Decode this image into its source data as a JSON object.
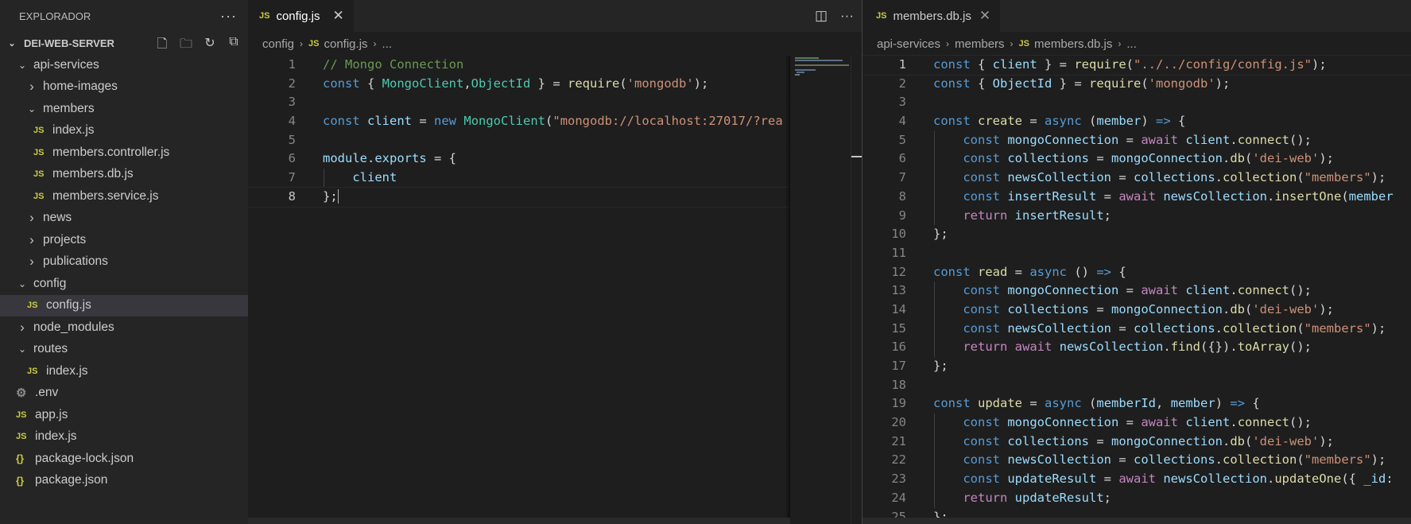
{
  "sidebar": {
    "title": "EXPLORADOR",
    "more_icon": "ellipsis-icon",
    "project": "DEI-WEB-SERVER",
    "tree": [
      {
        "label": "api-services",
        "kind": "folder-open",
        "depth": 1
      },
      {
        "label": "home-images",
        "kind": "folder-closed",
        "depth": 2
      },
      {
        "label": "members",
        "kind": "folder-open",
        "depth": 2
      },
      {
        "label": "index.js",
        "kind": "js",
        "depth": 3
      },
      {
        "label": "members.controller.js",
        "kind": "js",
        "depth": 3
      },
      {
        "label": "members.db.js",
        "kind": "js",
        "depth": 3
      },
      {
        "label": "members.service.js",
        "kind": "js",
        "depth": 3
      },
      {
        "label": "news",
        "kind": "folder-closed",
        "depth": 2
      },
      {
        "label": "projects",
        "kind": "folder-closed",
        "depth": 2
      },
      {
        "label": "publications",
        "kind": "folder-closed",
        "depth": 2
      },
      {
        "label": "config",
        "kind": "folder-open",
        "depth": 1
      },
      {
        "label": "config.js",
        "kind": "js",
        "depth": 2,
        "selected": true
      },
      {
        "label": "node_modules",
        "kind": "folder-closed",
        "depth": 1
      },
      {
        "label": "routes",
        "kind": "folder-open",
        "depth": 1
      },
      {
        "label": "index.js",
        "kind": "js",
        "depth": 2
      },
      {
        "label": ".env",
        "kind": "env",
        "depth": 1
      },
      {
        "label": "app.js",
        "kind": "js",
        "depth": 1
      },
      {
        "label": "index.js",
        "kind": "js",
        "depth": 1
      },
      {
        "label": "package-lock.json",
        "kind": "json",
        "depth": 1
      },
      {
        "label": "package.json",
        "kind": "json",
        "depth": 1
      }
    ]
  },
  "icons": {
    "js": "JS",
    "json": "{}",
    "env": "⚙",
    "chev_open": "⌄",
    "chev_closed": "›",
    "close": "✕"
  },
  "left_editor": {
    "tab": "config.js",
    "breadcrumb": [
      "config",
      "config.js",
      "..."
    ],
    "current_line": 8,
    "lines": [
      [
        [
          "cmt",
          "// Mongo Connection"
        ]
      ],
      [
        [
          "kw",
          "const"
        ],
        [
          "pun",
          " { "
        ],
        [
          "cls",
          "MongoClient"
        ],
        [
          "pun",
          ","
        ],
        [
          "cls",
          "ObjectId"
        ],
        [
          "pun",
          " } = "
        ],
        [
          "fn",
          "require"
        ],
        [
          "pun",
          "("
        ],
        [
          "str",
          "'mongodb'"
        ],
        [
          "pun",
          ");"
        ]
      ],
      [],
      [
        [
          "kw",
          "const"
        ],
        [
          "pun",
          " "
        ],
        [
          "var",
          "client"
        ],
        [
          "pun",
          " = "
        ],
        [
          "kw",
          "new"
        ],
        [
          "pun",
          " "
        ],
        [
          "cls",
          "MongoClient"
        ],
        [
          "pun",
          "("
        ],
        [
          "str",
          "\"mongodb://localhost:27017/?rea"
        ]
      ],
      [],
      [
        [
          "var",
          "module"
        ],
        [
          "pun",
          "."
        ],
        [
          "var",
          "exports"
        ],
        [
          "pun",
          " = {"
        ]
      ],
      [
        [
          "pun",
          "    "
        ],
        [
          "var",
          "client"
        ]
      ],
      [
        [
          "pun",
          "};"
        ]
      ]
    ]
  },
  "right_editor": {
    "tab": "members.db.js",
    "breadcrumb": [
      "api-services",
      "members",
      "members.db.js",
      "..."
    ],
    "current_line": 1,
    "lines": [
      [
        [
          "kw",
          "const"
        ],
        [
          "pun",
          " { "
        ],
        [
          "var",
          "client"
        ],
        [
          "pun",
          " } = "
        ],
        [
          "fn",
          "require"
        ],
        [
          "pun",
          "("
        ],
        [
          "str",
          "\"../../config/config.js\""
        ],
        [
          "pun",
          ");"
        ]
      ],
      [
        [
          "kw",
          "const"
        ],
        [
          "pun",
          " { "
        ],
        [
          "var",
          "ObjectId"
        ],
        [
          "pun",
          " } = "
        ],
        [
          "fn",
          "require"
        ],
        [
          "pun",
          "("
        ],
        [
          "str",
          "'mongodb'"
        ],
        [
          "pun",
          ");"
        ]
      ],
      [],
      [
        [
          "kw",
          "const"
        ],
        [
          "pun",
          " "
        ],
        [
          "fn",
          "create"
        ],
        [
          "pun",
          " = "
        ],
        [
          "kw",
          "async"
        ],
        [
          "pun",
          " ("
        ],
        [
          "var",
          "member"
        ],
        [
          "pun",
          ") "
        ],
        [
          "kw",
          "=>"
        ],
        [
          "pun",
          " {"
        ]
      ],
      [
        [
          "pun",
          "    "
        ],
        [
          "kw",
          "const"
        ],
        [
          "pun",
          " "
        ],
        [
          "var",
          "mongoConnection"
        ],
        [
          "pun",
          " = "
        ],
        [
          "ctl",
          "await"
        ],
        [
          "pun",
          " "
        ],
        [
          "var",
          "client"
        ],
        [
          "pun",
          "."
        ],
        [
          "fn",
          "connect"
        ],
        [
          "pun",
          "();"
        ]
      ],
      [
        [
          "pun",
          "    "
        ],
        [
          "kw",
          "const"
        ],
        [
          "pun",
          " "
        ],
        [
          "var",
          "collections"
        ],
        [
          "pun",
          " = "
        ],
        [
          "var",
          "mongoConnection"
        ],
        [
          "pun",
          "."
        ],
        [
          "fn",
          "db"
        ],
        [
          "pun",
          "("
        ],
        [
          "str",
          "'dei-web'"
        ],
        [
          "pun",
          ");"
        ]
      ],
      [
        [
          "pun",
          "    "
        ],
        [
          "kw",
          "const"
        ],
        [
          "pun",
          " "
        ],
        [
          "var",
          "newsCollection"
        ],
        [
          "pun",
          " = "
        ],
        [
          "var",
          "collections"
        ],
        [
          "pun",
          "."
        ],
        [
          "fn",
          "collection"
        ],
        [
          "pun",
          "("
        ],
        [
          "str",
          "\"members\""
        ],
        [
          "pun",
          ");"
        ]
      ],
      [
        [
          "pun",
          "    "
        ],
        [
          "kw",
          "const"
        ],
        [
          "pun",
          " "
        ],
        [
          "var",
          "insertResult"
        ],
        [
          "pun",
          " = "
        ],
        [
          "ctl",
          "await"
        ],
        [
          "pun",
          " "
        ],
        [
          "var",
          "newsCollection"
        ],
        [
          "pun",
          "."
        ],
        [
          "fn",
          "insertOne"
        ],
        [
          "pun",
          "("
        ],
        [
          "var",
          "member"
        ]
      ],
      [
        [
          "pun",
          "    "
        ],
        [
          "ctl",
          "return"
        ],
        [
          "pun",
          " "
        ],
        [
          "var",
          "insertResult"
        ],
        [
          "pun",
          ";"
        ]
      ],
      [
        [
          "pun",
          "};"
        ]
      ],
      [],
      [
        [
          "kw",
          "const"
        ],
        [
          "pun",
          " "
        ],
        [
          "fn",
          "read"
        ],
        [
          "pun",
          " = "
        ],
        [
          "kw",
          "async"
        ],
        [
          "pun",
          " () "
        ],
        [
          "kw",
          "=>"
        ],
        [
          "pun",
          " {"
        ]
      ],
      [
        [
          "pun",
          "    "
        ],
        [
          "kw",
          "const"
        ],
        [
          "pun",
          " "
        ],
        [
          "var",
          "mongoConnection"
        ],
        [
          "pun",
          " = "
        ],
        [
          "ctl",
          "await"
        ],
        [
          "pun",
          " "
        ],
        [
          "var",
          "client"
        ],
        [
          "pun",
          "."
        ],
        [
          "fn",
          "connect"
        ],
        [
          "pun",
          "();"
        ]
      ],
      [
        [
          "pun",
          "    "
        ],
        [
          "kw",
          "const"
        ],
        [
          "pun",
          " "
        ],
        [
          "var",
          "collections"
        ],
        [
          "pun",
          " = "
        ],
        [
          "var",
          "mongoConnection"
        ],
        [
          "pun",
          "."
        ],
        [
          "fn",
          "db"
        ],
        [
          "pun",
          "("
        ],
        [
          "str",
          "'dei-web'"
        ],
        [
          "pun",
          ");"
        ]
      ],
      [
        [
          "pun",
          "    "
        ],
        [
          "kw",
          "const"
        ],
        [
          "pun",
          " "
        ],
        [
          "var",
          "newsCollection"
        ],
        [
          "pun",
          " = "
        ],
        [
          "var",
          "collections"
        ],
        [
          "pun",
          "."
        ],
        [
          "fn",
          "collection"
        ],
        [
          "pun",
          "("
        ],
        [
          "str",
          "\"members\""
        ],
        [
          "pun",
          ");"
        ]
      ],
      [
        [
          "pun",
          "    "
        ],
        [
          "ctl",
          "return"
        ],
        [
          "pun",
          " "
        ],
        [
          "ctl",
          "await"
        ],
        [
          "pun",
          " "
        ],
        [
          "var",
          "newsCollection"
        ],
        [
          "pun",
          "."
        ],
        [
          "fn",
          "find"
        ],
        [
          "pun",
          "({})."
        ],
        [
          "fn",
          "toArray"
        ],
        [
          "pun",
          "();"
        ]
      ],
      [
        [
          "pun",
          "};"
        ]
      ],
      [],
      [
        [
          "kw",
          "const"
        ],
        [
          "pun",
          " "
        ],
        [
          "fn",
          "update"
        ],
        [
          "pun",
          " = "
        ],
        [
          "kw",
          "async"
        ],
        [
          "pun",
          " ("
        ],
        [
          "var",
          "memberId"
        ],
        [
          "pun",
          ", "
        ],
        [
          "var",
          "member"
        ],
        [
          "pun",
          ") "
        ],
        [
          "kw",
          "=>"
        ],
        [
          "pun",
          " {"
        ]
      ],
      [
        [
          "pun",
          "    "
        ],
        [
          "kw",
          "const"
        ],
        [
          "pun",
          " "
        ],
        [
          "var",
          "mongoConnection"
        ],
        [
          "pun",
          " = "
        ],
        [
          "ctl",
          "await"
        ],
        [
          "pun",
          " "
        ],
        [
          "var",
          "client"
        ],
        [
          "pun",
          "."
        ],
        [
          "fn",
          "connect"
        ],
        [
          "pun",
          "();"
        ]
      ],
      [
        [
          "pun",
          "    "
        ],
        [
          "kw",
          "const"
        ],
        [
          "pun",
          " "
        ],
        [
          "var",
          "collections"
        ],
        [
          "pun",
          " = "
        ],
        [
          "var",
          "mongoConnection"
        ],
        [
          "pun",
          "."
        ],
        [
          "fn",
          "db"
        ],
        [
          "pun",
          "("
        ],
        [
          "str",
          "'dei-web'"
        ],
        [
          "pun",
          ");"
        ]
      ],
      [
        [
          "pun",
          "    "
        ],
        [
          "kw",
          "const"
        ],
        [
          "pun",
          " "
        ],
        [
          "var",
          "newsCollection"
        ],
        [
          "pun",
          " = "
        ],
        [
          "var",
          "collections"
        ],
        [
          "pun",
          "."
        ],
        [
          "fn",
          "collection"
        ],
        [
          "pun",
          "("
        ],
        [
          "str",
          "\"members\""
        ],
        [
          "pun",
          ");"
        ]
      ],
      [
        [
          "pun",
          "    "
        ],
        [
          "kw",
          "const"
        ],
        [
          "pun",
          " "
        ],
        [
          "var",
          "updateResult"
        ],
        [
          "pun",
          " = "
        ],
        [
          "ctl",
          "await"
        ],
        [
          "pun",
          " "
        ],
        [
          "var",
          "newsCollection"
        ],
        [
          "pun",
          "."
        ],
        [
          "fn",
          "updateOne"
        ],
        [
          "pun",
          "({ "
        ],
        [
          "var",
          "_id"
        ],
        [
          "pun",
          ":"
        ]
      ],
      [
        [
          "pun",
          "    "
        ],
        [
          "ctl",
          "return"
        ],
        [
          "pun",
          " "
        ],
        [
          "var",
          "updateResult"
        ],
        [
          "pun",
          ";"
        ]
      ],
      [
        [
          "pun",
          "};"
        ]
      ]
    ]
  }
}
